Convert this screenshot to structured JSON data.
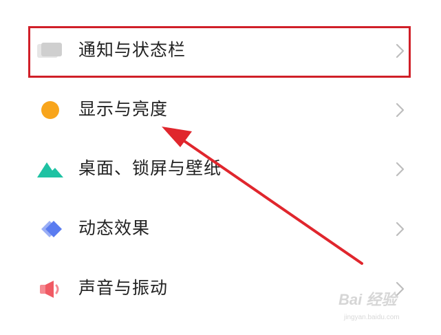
{
  "settings": {
    "items": [
      {
        "label": "通知与状态栏",
        "icon": "notification-bar-icon",
        "icon_color": "#d9d9d9"
      },
      {
        "label": "显示与亮度",
        "icon": "display-brightness-icon",
        "icon_color": "#f8a51c"
      },
      {
        "label": "桌面、锁屏与壁纸",
        "icon": "wallpaper-icon",
        "icon_color": "#1fc2a3"
      },
      {
        "label": "动态效果",
        "icon": "motion-effects-icon",
        "icon_color": "#5a7cf0"
      },
      {
        "label": "声音与振动",
        "icon": "sound-vibration-icon",
        "icon_color": "#f05a64"
      }
    ],
    "chevron_icon": "chevron-right-icon"
  },
  "annotations": {
    "highlight_color": "#d01f28",
    "arrow_color": "#e0262d"
  },
  "watermark": {
    "main": "Bai 经验",
    "sub": "jingyan.baidu.com"
  }
}
